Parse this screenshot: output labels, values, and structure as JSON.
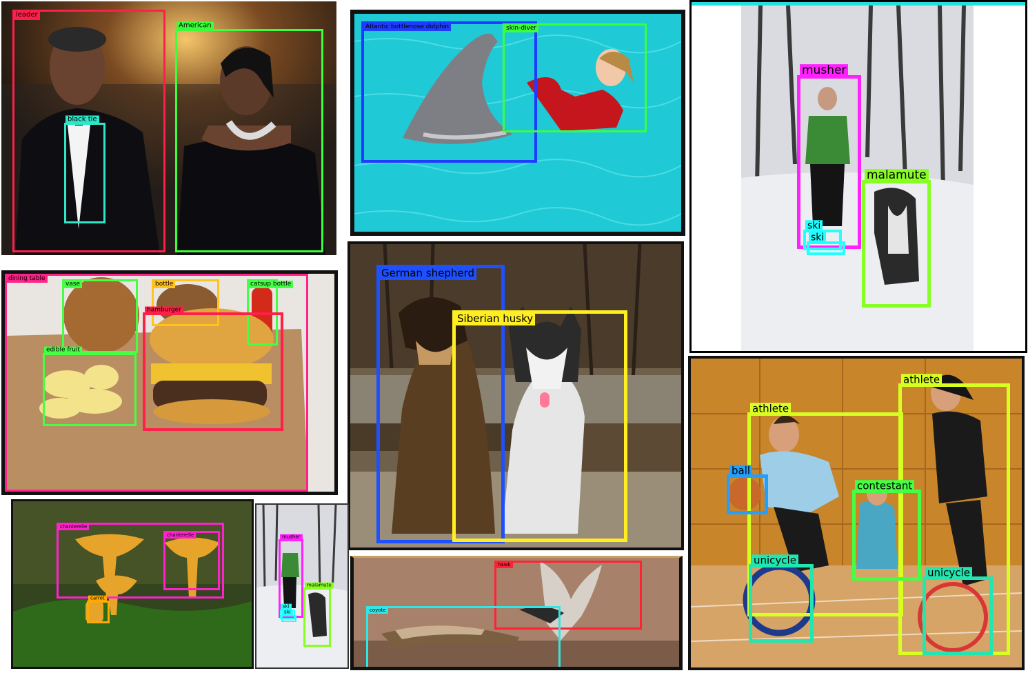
{
  "panels": [
    {
      "id": "obama",
      "labels": {
        "leader": "leader",
        "american": "American",
        "black_tie": "black tie"
      },
      "colors": {
        "leader": "#ff1f4b",
        "american": "#3cff3c",
        "black_tie": "#2ee6c8"
      }
    },
    {
      "id": "dolphin",
      "labels": {
        "dolphin": "Atlantic bottlenose dolphin",
        "diver": "skin-diver"
      },
      "colors": {
        "dolphin": "#1e3cff",
        "diver": "#3cff3c"
      }
    },
    {
      "id": "musher-large",
      "labels": {
        "musher": "musher",
        "malamute": "malamute",
        "ski1": "ski",
        "ski2": "ski"
      },
      "colors": {
        "musher": "#ff22ff",
        "malamute": "#88ff22",
        "ski": "#22ffff"
      }
    },
    {
      "id": "burger",
      "labels": {
        "dining_table": "dining table",
        "vase": "vase",
        "bottle": "bottle",
        "catsup": "catsup bottle",
        "hamburger": "hamburger",
        "fruit": "edible fruit"
      },
      "colors": {
        "dining_table": "#ff2288",
        "vase": "#44ff44",
        "bottle": "#ffc21e",
        "catsup": "#44ff44",
        "hamburger": "#ff1f4b",
        "fruit": "#44ff44"
      }
    },
    {
      "id": "dogs",
      "labels": {
        "shepherd": "German shepherd",
        "husky": "Siberian husky"
      },
      "colors": {
        "shepherd": "#1e50ff",
        "husky": "#ffee22"
      }
    },
    {
      "id": "unicycle",
      "labels": {
        "athlete1": "athlete",
        "athlete2": "athlete",
        "ball": "ball",
        "contestant": "contestant",
        "unicycle1": "unicycle",
        "unicycle2": "unicycle"
      },
      "colors": {
        "athlete": "#d8ff22",
        "ball": "#22a0ff",
        "contestant": "#44ff44",
        "unicycle": "#22e6b0"
      }
    },
    {
      "id": "mushroom",
      "labels": {
        "chanterelle1": "chanterelle",
        "chanterelle2": "chanterelle",
        "carrot": "carrot"
      },
      "colors": {
        "chanterelle": "#ff22cc",
        "carrot": "#ffaa00"
      }
    },
    {
      "id": "musher-small",
      "labels": {
        "musher": "musher",
        "malamute": "malamute",
        "ski1": "ski",
        "ski2": "ski"
      },
      "colors": {
        "musher": "#ff22ff",
        "malamute": "#88ff22",
        "ski": "#22ffff"
      }
    },
    {
      "id": "hawk",
      "labels": {
        "hawk": "hawk",
        "coyote": "coyote"
      },
      "colors": {
        "hawk": "#ff2233",
        "coyote": "#33e6e6"
      }
    }
  ]
}
